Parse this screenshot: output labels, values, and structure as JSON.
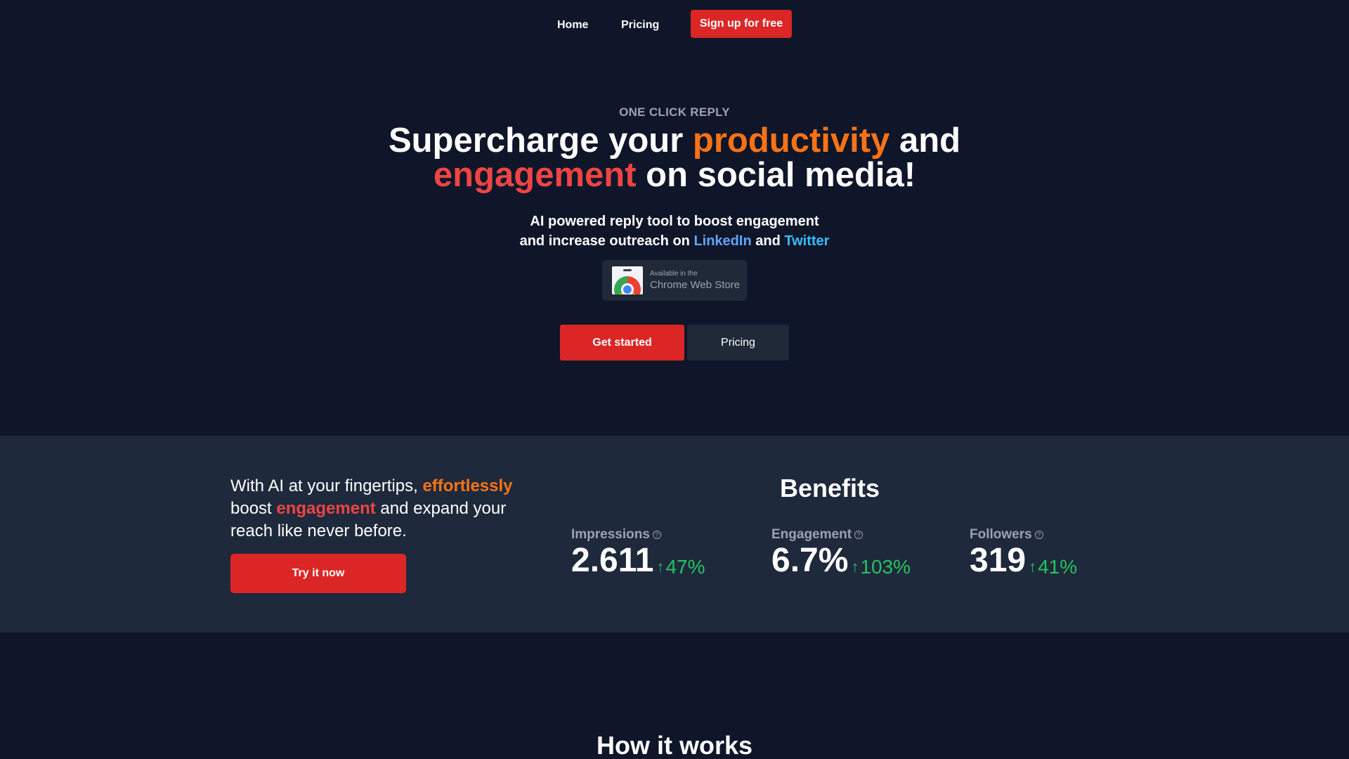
{
  "nav": {
    "home": "Home",
    "pricing": "Pricing",
    "signup": "Sign up for free"
  },
  "hero": {
    "eyebrow": "ONE CLICK REPLY",
    "headline_1a": "Supercharge your ",
    "headline_1b": "productivity",
    "headline_1c": " and",
    "headline_2a": "engagement",
    "headline_2b": " on social media!",
    "sub_1": "AI powered reply tool to boost engagement",
    "sub_2a": "and increase outreach on ",
    "sub_2b": "LinkedIn",
    "sub_2c": " and ",
    "sub_2d": "Twitter",
    "cws_small": "Available in the",
    "cws_big": "Chrome Web Store",
    "cta_primary": "Get started",
    "cta_secondary": "Pricing"
  },
  "band": {
    "copy_a": "With AI at your fingertips, ",
    "copy_b": "effortlessly",
    "copy_c": " boost ",
    "copy_d": "engagement",
    "copy_e": " and expand your reach like never before.",
    "try_btn": "Try it now",
    "benefits_title": "Benefits",
    "stats": [
      {
        "label": "Impressions",
        "value": "2.611",
        "delta": "47%"
      },
      {
        "label": "Engagement",
        "value": "6.7%",
        "delta": "103%"
      },
      {
        "label": "Followers",
        "value": "319",
        "delta": "41%"
      }
    ]
  },
  "how": {
    "title": "How it works"
  },
  "colors": {
    "bg": "#0f1629",
    "band": "#1e293b",
    "accent_red": "#dc2626",
    "accent_orange": "#f97316",
    "positive_green": "#22c55e",
    "linkedin_blue": "#60a5fa",
    "twitter_blue": "#38bdf8"
  },
  "icons": [
    "chrome-web-store-icon",
    "help-circle-icon",
    "arrow-up-icon"
  ]
}
